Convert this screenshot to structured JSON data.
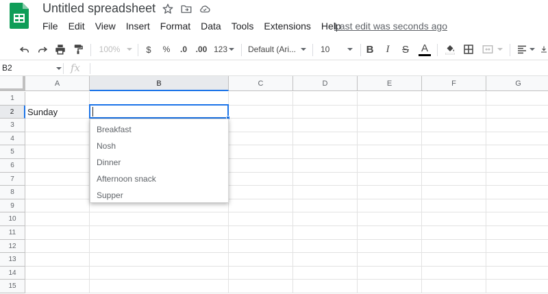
{
  "app": {
    "title": "Untitled spreadsheet",
    "last_edit": "Last edit was seconds ago",
    "brand_color": "#0f9d58"
  },
  "menu": [
    "File",
    "Edit",
    "View",
    "Insert",
    "Format",
    "Data",
    "Tools",
    "Extensions",
    "Help"
  ],
  "toolbar": {
    "zoom": "100%",
    "currency": "$",
    "percent": "%",
    "decrease_decimal": ".0",
    "increase_decimal": ".00",
    "number_format": "123",
    "font_family": "Default (Ari...",
    "font_size": "10",
    "bold": "B",
    "italic": "I",
    "strikethrough": "S",
    "text_color": "A"
  },
  "formula_bar": {
    "cell_ref": "B2",
    "fx": "fx",
    "value": ""
  },
  "grid": {
    "columns": [
      "A",
      "B",
      "C",
      "D",
      "E",
      "F",
      "G"
    ],
    "rows": [
      "1",
      "2",
      "3",
      "4",
      "5",
      "6",
      "7",
      "8",
      "9",
      "10",
      "11",
      "12",
      "13",
      "14",
      "15"
    ],
    "cells": {
      "A2": "Sunday",
      "B2": ""
    },
    "selected_cell": "B2",
    "selection_color": "#1a73e8"
  },
  "autocomplete": {
    "options": [
      "Breakfast",
      "Nosh",
      "Dinner",
      "Afternoon snack",
      "Supper"
    ]
  }
}
